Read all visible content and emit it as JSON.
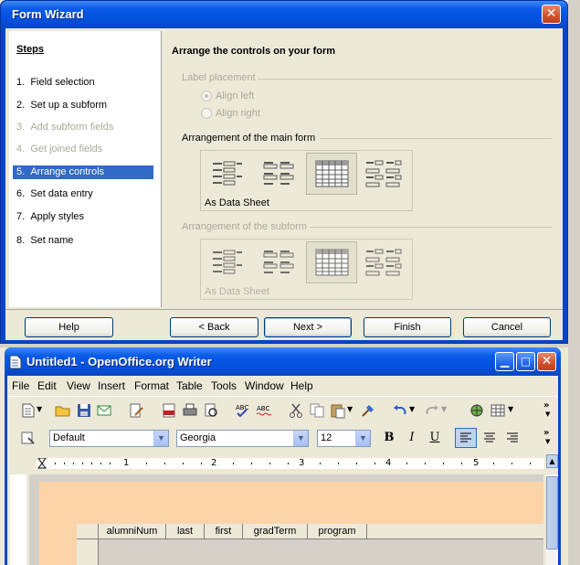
{
  "wizard": {
    "title": "Form Wizard",
    "steps_title": "Steps",
    "steps": [
      {
        "num": "1.",
        "label": "Field selection",
        "state": "enabled"
      },
      {
        "num": "2.",
        "label": "Set up a subform",
        "state": "enabled"
      },
      {
        "num": "3.",
        "label": "Add subform fields",
        "state": "disabled"
      },
      {
        "num": "4.",
        "label": "Get joined fields",
        "state": "disabled"
      },
      {
        "num": "5.",
        "label": "Arrange controls",
        "state": "selected"
      },
      {
        "num": "6.",
        "label": "Set data entry",
        "state": "enabled"
      },
      {
        "num": "7.",
        "label": "Apply styles",
        "state": "enabled"
      },
      {
        "num": "8.",
        "label": "Set name",
        "state": "enabled"
      }
    ],
    "content_title": "Arrange the controls on your form",
    "label_placement": "Label placement",
    "align_left": "Align left",
    "align_right": "Align right",
    "main_form_arrangement": "Arrangement of the main form",
    "main_form_selected_label": "As Data Sheet",
    "subform_arrangement": "Arrangement of the subform",
    "subform_selected_label": "As Data Sheet",
    "buttons": {
      "help": "Help",
      "back": "< Back",
      "next": "Next >",
      "finish": "Finish",
      "cancel": "Cancel"
    }
  },
  "writer": {
    "title": "Untitled1 - OpenOffice.org Writer",
    "menu": [
      "File",
      "Edit",
      "View",
      "Insert",
      "Format",
      "Table",
      "Tools",
      "Window",
      "Help"
    ],
    "paragraph_style": "Default",
    "font_name": "Georgia",
    "font_size": "12",
    "bold": "B",
    "italic": "I",
    "underline": "U",
    "ruler_numbers": [
      "1",
      "2",
      "3",
      "4",
      "5"
    ],
    "table_columns": [
      "alumniNum",
      "last",
      "first",
      "gradTerm",
      "program"
    ],
    "colors": {
      "page_band": "#fdd3a8",
      "title_blue": "#0a5ae8",
      "selection": "#316ac5"
    }
  }
}
